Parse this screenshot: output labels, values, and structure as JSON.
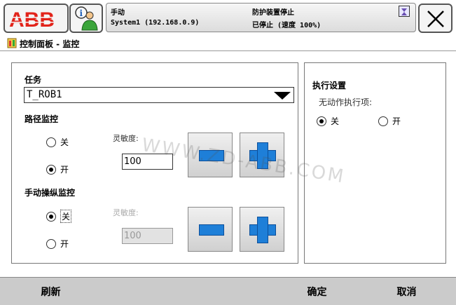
{
  "topbar": {
    "logo_text": "ABB",
    "status": {
      "mode": "手动",
      "system": "System1 (192.168.0.9)",
      "guard": "防护装置停止",
      "stopped": "已停止 (速度 100%)"
    }
  },
  "breadcrumb": {
    "title": "控制面板 - 监控"
  },
  "left": {
    "task_label": "任务",
    "task_value": "T_ROB1",
    "path_title": "路径监控",
    "path_off": "关",
    "path_on": "开",
    "path_sens_label": "灵敏度:",
    "path_sens_value": "100",
    "path_selected": "on",
    "jog_title": "手动操纵监控",
    "jog_off": "关",
    "jog_on": "开",
    "jog_sens_label": "灵敏度:",
    "jog_sens_value": "100",
    "jog_selected": "off"
  },
  "right": {
    "title": "执行设置",
    "subtitle": "无动作执行项:",
    "off": "关",
    "on": "开",
    "selected": "off"
  },
  "watermark": "WWW.ZD-ABB.COM",
  "bottom": {
    "refresh": "刷新",
    "ok": "确定",
    "cancel": "取消"
  },
  "colors": {
    "abb_red": "#e2231a",
    "button_blue": "#1e7fd8",
    "bottom_bar": "#cbcbcb"
  }
}
